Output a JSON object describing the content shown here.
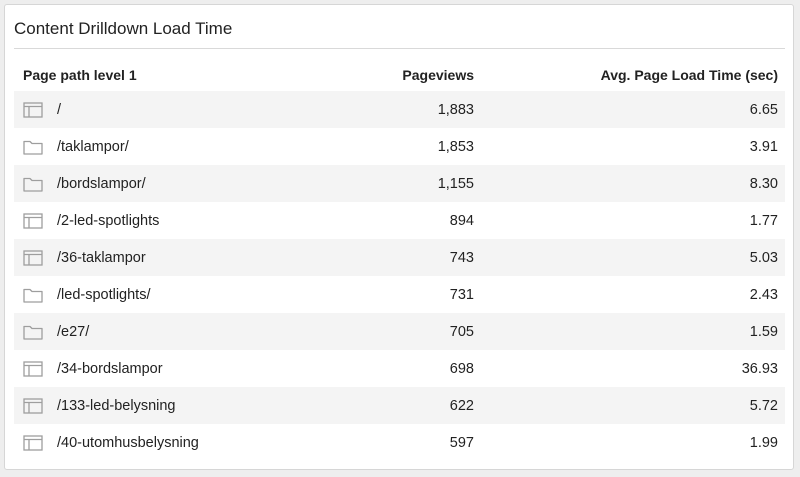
{
  "widget": {
    "title": "Content Drilldown Load Time"
  },
  "columns": {
    "path": "Page path level 1",
    "pageviews": "Pageviews",
    "load_time": "Avg. Page Load Time (sec)"
  },
  "rows": [
    {
      "icon": "page-icon",
      "path": "/",
      "pageviews": "1,883",
      "load_time": "6.65"
    },
    {
      "icon": "folder-icon",
      "path": "/taklampor/",
      "pageviews": "1,853",
      "load_time": "3.91"
    },
    {
      "icon": "folder-icon",
      "path": "/bordslampor/",
      "pageviews": "1,155",
      "load_time": "8.30"
    },
    {
      "icon": "page-icon",
      "path": "/2-led-spotlights",
      "pageviews": "894",
      "load_time": "1.77"
    },
    {
      "icon": "page-icon",
      "path": "/36-taklampor",
      "pageviews": "743",
      "load_time": "5.03"
    },
    {
      "icon": "folder-icon",
      "path": "/led-spotlights/",
      "pageviews": "731",
      "load_time": "2.43"
    },
    {
      "icon": "folder-icon",
      "path": "/e27/",
      "pageviews": "705",
      "load_time": "1.59"
    },
    {
      "icon": "page-icon",
      "path": "/34-bordslampor",
      "pageviews": "698",
      "load_time": "36.93"
    },
    {
      "icon": "page-icon",
      "path": "/133-led-belysning",
      "pageviews": "622",
      "load_time": "5.72"
    },
    {
      "icon": "page-icon",
      "path": "/40-utomhusbelysning",
      "pageviews": "597",
      "load_time": "1.99"
    }
  ],
  "colors": {
    "icon": "#9e9e9e",
    "row_alt": "#f4f4f4",
    "text": "#222222"
  }
}
